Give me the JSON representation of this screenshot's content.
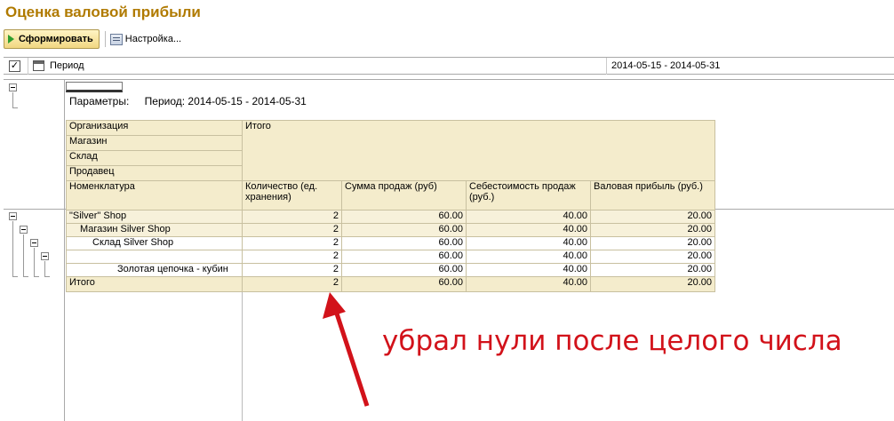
{
  "window": {
    "title": "Оценка валовой прибыли"
  },
  "toolbar": {
    "generate_label": "Сформировать",
    "settings_label": "Настройка..."
  },
  "settings_row": {
    "checked": true,
    "label": "Период",
    "value": "2014-05-15 - 2014-05-31"
  },
  "report": {
    "params_label": "Параметры:",
    "params_text": "Период: 2014-05-15 - 2014-05-31",
    "header": {
      "organization": "Организация",
      "shop": "Магазин",
      "warehouse": "Склад",
      "seller": "Продавец",
      "nomenclature": "Номенклатура",
      "total_group": "Итого",
      "qty": "Количество (ед. хранения)",
      "sales_sum": "Сумма продаж (руб)",
      "cost": "Себестоимость продаж (руб.)",
      "gross_profit": "Валовая прибыль (руб.)"
    },
    "rows": [
      {
        "name": "\"Silver\" Shop",
        "qty": "2",
        "sum": "60.00",
        "cost": "40.00",
        "profit": "20.00"
      },
      {
        "name": "Магазин Silver Shop",
        "qty": "2",
        "sum": "60.00",
        "cost": "40.00",
        "profit": "20.00"
      },
      {
        "name": "Склад Silver Shop",
        "qty": "2",
        "sum": "60.00",
        "cost": "40.00",
        "profit": "20.00"
      },
      {
        "name": "",
        "qty": "2",
        "sum": "60.00",
        "cost": "40.00",
        "profit": "20.00"
      },
      {
        "name": "Золотая цепочка - кубин",
        "qty": "2",
        "sum": "60.00",
        "cost": "40.00",
        "profit": "20.00"
      }
    ],
    "total": {
      "label": "Итого",
      "qty": "2",
      "sum": "60.00",
      "cost": "40.00",
      "profit": "20.00"
    }
  },
  "annotation": {
    "text": "убрал нули после целого числа",
    "color": "#d2121a"
  }
}
